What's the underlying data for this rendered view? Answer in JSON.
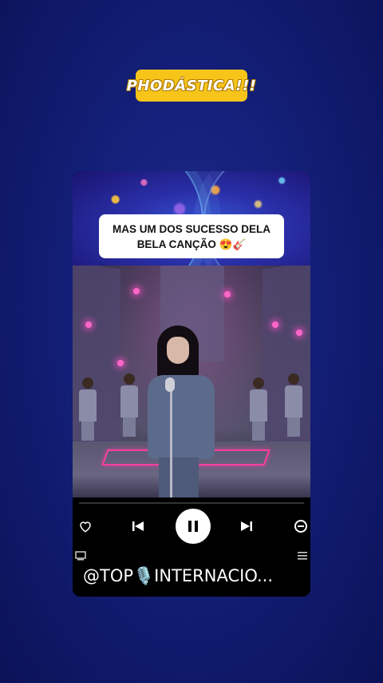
{
  "badge": {
    "text": "PHODÁSTICA!!!"
  },
  "caption": {
    "line1": "MAS UM DOS SUCESSO DELA",
    "line2": "BELA CANÇÃO 😍🎸"
  },
  "player": {
    "handle": "@TOP🎙️INTERNACIO...",
    "icons": [
      "heart-icon",
      "previous-icon",
      "pause-icon",
      "next-icon",
      "minus-circle-icon",
      "cast-icon",
      "menu-icon"
    ]
  },
  "colors": {
    "background": "#14207a",
    "badge": "#f7c51a",
    "caption_bg": "#ffffff",
    "player_bg": "#000000"
  }
}
